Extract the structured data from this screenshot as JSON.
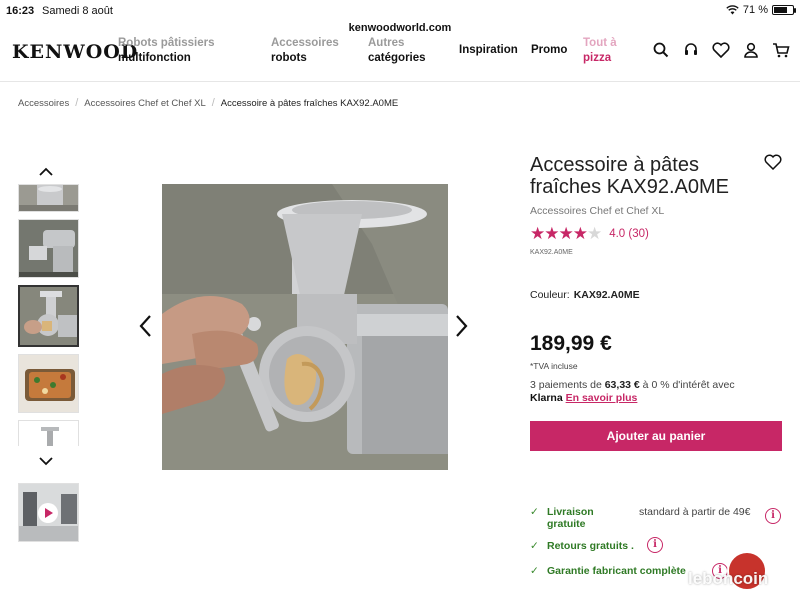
{
  "status_bar": {
    "time": "16:23",
    "date": "Samedi 8 août",
    "battery": "71 %",
    "battery_level": 0.71
  },
  "browser": {
    "url": "kenwoodworld.com"
  },
  "header": {
    "logo": "KENWOOD",
    "nav": [
      {
        "line1": "Robots pâtissiers",
        "line2": "multifonction"
      },
      {
        "line1": "Accessoires",
        "line2": "robots"
      },
      {
        "line1": "Autres",
        "line2": "catégories"
      },
      {
        "line1": "",
        "line2": "Inspiration"
      },
      {
        "line1": "",
        "line2": "Promo"
      },
      {
        "line1": "Tout à",
        "line2": "pizza"
      }
    ],
    "icons": [
      "search-icon",
      "headset-icon",
      "heart-icon",
      "account-icon",
      "cart-icon"
    ]
  },
  "breadcrumb": {
    "items": [
      "Accessoires",
      "Accessoires Chef et Chef XL"
    ],
    "current": "Accessoire à pâtes fraîches KAX92.A0ME"
  },
  "gallery": {
    "thumbnails": [
      "pasta-attachment-detail",
      "mixer-with-attachment",
      "pasta-attachment-in-use",
      "baked-pasta-dish",
      "attachment-product-shot",
      "video-thumbnail"
    ],
    "active_index": 2
  },
  "product": {
    "title": "Accessoire à pâtes fraîches KAX92.A0ME",
    "subtitle": "Accessoires Chef et Chef XL",
    "rating": 4.0,
    "rating_text": "4.0 (30)",
    "sku": "KAX92.A0ME",
    "color_label": "Couleur:",
    "color_value": "KAX92.A0ME",
    "price": "189,99 €",
    "tva": "*TVA incluse",
    "klarna": {
      "prefix": "3 paiements de ",
      "amount": "63,33 €",
      "suffix": " à 0 % d'intérêt avec",
      "brand": "Klarna",
      "link": "En savoir plus"
    },
    "add_to_cart": "Ajouter au panier"
  },
  "perks": [
    {
      "label": "Livraison gratuite",
      "desc": "standard à partir de 49€"
    },
    {
      "label": "Retours gratuits .",
      "desc": ""
    },
    {
      "label": "Garantie fabricant complète",
      "desc": ""
    }
  ],
  "colors": {
    "accent": "#c72766",
    "perk_green": "#2f7a25"
  },
  "watermark": "leboncoin"
}
